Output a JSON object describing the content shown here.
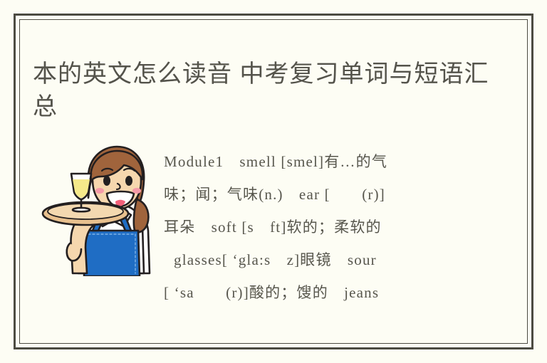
{
  "page": {
    "background_color": "#fdfdf4",
    "frame_color": "#4c4b42",
    "text_color": "#57564d"
  },
  "article": {
    "title": "本的英文怎么读音 中考复习单词与短语汇总",
    "title_line_1": "本的英文怎么读音 中考复习单词",
    "title_line_2": "与短语汇总"
  },
  "illustration": {
    "name": "waitress-with-tray-illustration",
    "description": "卡通女服务员端托盘与酒杯",
    "colors": {
      "hair": "#a0643c",
      "skin": "#f6d7ae",
      "apron": "#1f6dc4",
      "shirt": "#ffffff",
      "tray": "#e8c08e",
      "drink": "#f5e98a",
      "outline": "#231f20",
      "blush": "#f59aa8",
      "mouth": "#f2607a"
    }
  },
  "vocabulary": {
    "lines": [
      "Module1　smell [smel]有…的气",
      "味；闻；气味(n.)　ear [　　(r)]",
      "耳朵　soft [s　ft]软的；柔软的",
      "glasses[ ‘gla:s　z]眼镜　sour",
      "[ ‘sa　　(r)]酸的；馊的　jeans"
    ],
    "entries": [
      {
        "module": "Module1",
        "word": "smell",
        "phonetic": "[smel]",
        "meaning": "有…的气味；闻；气味(n.)"
      },
      {
        "word": "ear",
        "phonetic": "[　(r)]",
        "meaning": "耳朵"
      },
      {
        "word": "soft",
        "phonetic": "[s ft]",
        "meaning": "软的；柔软的"
      },
      {
        "word": "glasses",
        "phonetic": "[ ‘gla:s z]",
        "meaning": "眼镜"
      },
      {
        "word": "sour",
        "phonetic": "[ ‘sa (r)]",
        "meaning": "酸的；馊的"
      },
      {
        "word": "jeans",
        "phonetic": "",
        "meaning": ""
      }
    ]
  }
}
